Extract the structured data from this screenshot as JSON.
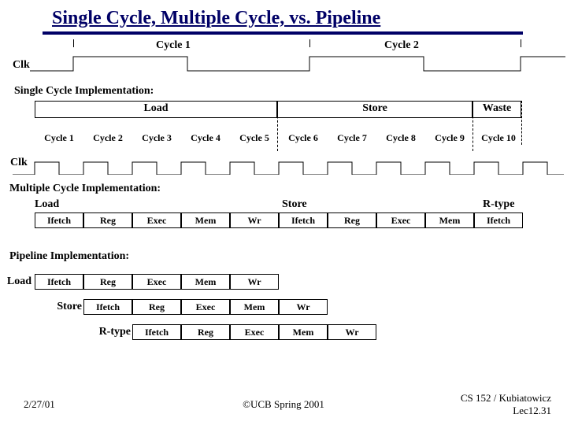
{
  "title": "Single Cycle, Multiple Cycle, vs. Pipeline",
  "labels": {
    "clk": "Clk",
    "cycle1": "Cycle 1",
    "cycle2": "Cycle 2",
    "mcycles": [
      "Cycle 1",
      "Cycle 2",
      "Cycle 3",
      "Cycle 4",
      "Cycle 5",
      "Cycle 6",
      "Cycle 7",
      "Cycle 8",
      "Cycle 9",
      "Cycle 10"
    ]
  },
  "sections": {
    "single": "Single Cycle Implementation:",
    "multi": "Multiple Cycle Implementation:",
    "pipeline": "Pipeline Implementation:"
  },
  "single_row": {
    "load": "Load",
    "store": "Store",
    "waste": "Waste"
  },
  "multi": {
    "load": {
      "lbl": "Load",
      "stages": [
        "Ifetch",
        "Reg",
        "Exec",
        "Mem",
        "Wr"
      ]
    },
    "store": {
      "lbl": "Store",
      "stages": [
        "Ifetch",
        "Reg",
        "Exec",
        "Mem"
      ]
    },
    "rtype": {
      "lbl": "R-type",
      "stages": [
        "Ifetch"
      ]
    }
  },
  "pipeline": {
    "load": {
      "lbl": "Load",
      "stages": [
        "Ifetch",
        "Reg",
        "Exec",
        "Mem",
        "Wr"
      ]
    },
    "store": {
      "lbl": "Store",
      "stages": [
        "Ifetch",
        "Reg",
        "Exec",
        "Mem",
        "Wr"
      ]
    },
    "rtype": {
      "lbl": "R-type",
      "stages": [
        "Ifetch",
        "Reg",
        "Exec",
        "Mem",
        "Wr"
      ]
    }
  },
  "footer": {
    "date": "2/27/01",
    "copy": "©UCB Spring 2001",
    "course": "CS 152 / Kubiatowicz",
    "lec": "Lec12.31"
  }
}
